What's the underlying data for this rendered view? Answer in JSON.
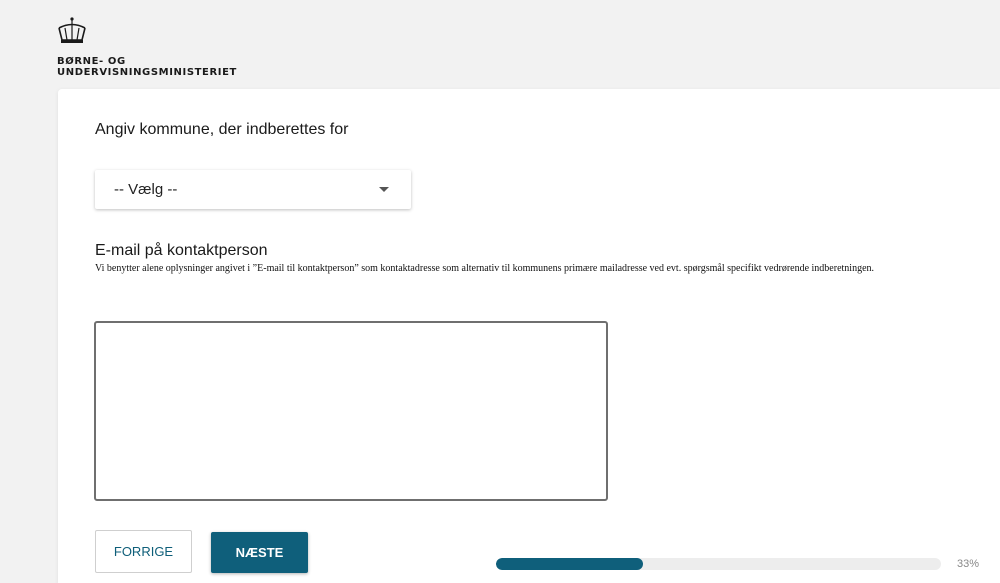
{
  "header": {
    "ministry_line1": "BØRNE- OG",
    "ministry_line2": "UNDERVISNINGSMINISTERIET",
    "logo_icon": "crown-icon"
  },
  "form": {
    "municipality_question": "Angiv kommune, der indberettes for",
    "municipality_select_value": "-- Vælg --",
    "email_question": "E-mail på kontaktperson",
    "email_description": "Vi benytter alene oplysninger angivet i ”E-mail til kontaktperson” som kontaktadresse som alternativ til kommunens primære mailadresse ved evt. spørgsmål specifikt vedrørende indberetningen.",
    "email_value": ""
  },
  "navigation": {
    "prev_label": "FORRIGE",
    "next_label": "NÆSTE"
  },
  "progress": {
    "percent": 33,
    "label": "33%"
  },
  "colors": {
    "accent": "#0f5f7b",
    "background": "#f2f2f2",
    "card": "#ffffff"
  }
}
